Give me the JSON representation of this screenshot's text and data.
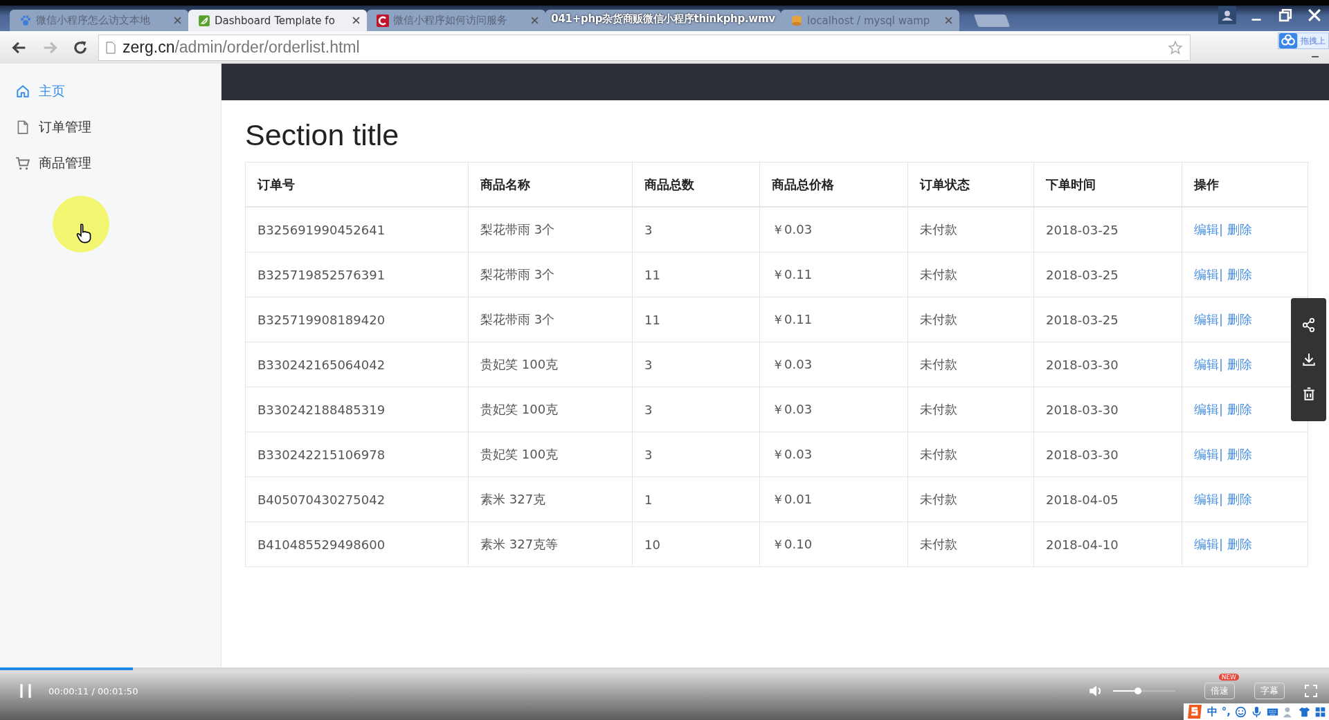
{
  "video": {
    "title": "041+php杂货商贩微信小程序thinkphp.wmv",
    "time": "00:00:11 / 00:01:50",
    "progress": {
      "level": 0.1
    },
    "volume": {
      "level": 0.4
    },
    "buttons": [
      {
        "label": "倍速",
        "badge": "NEW"
      },
      {
        "label": "字幕"
      }
    ]
  },
  "browser": {
    "tabs": [
      {
        "label": "微信小程序怎么访文本地",
        "selected": false,
        "kind": "paw"
      },
      {
        "label": "Dashboard Template fo",
        "selected": true,
        "kind": "leaf"
      },
      {
        "label": "微信小程序如何访问服务",
        "selected": false,
        "kind": "c"
      },
      {
        "label": "localhost / mysql wamp",
        "selected": false,
        "kind": "db"
      }
    ],
    "url": {
      "host": "zerg.cn",
      "path": "/admin/order/orderlist.html"
    },
    "extension_label": "拖拽上"
  },
  "sidebar": {
    "items": [
      {
        "label": "主页",
        "selected": true,
        "kind": "home"
      },
      {
        "label": "订单管理",
        "selected": false,
        "kind": "file"
      },
      {
        "label": "商品管理",
        "selected": false,
        "kind": "cart"
      }
    ]
  },
  "section_title": "Section title",
  "table": {
    "columns": [
      "订单号",
      "商品名称",
      "商品总数",
      "商品总价格",
      "订单状态",
      "下单时间",
      "操作"
    ],
    "action_separator": "|",
    "rows": [
      {
        "cells": [
          "B325691990452641",
          "梨花带雨 3个",
          "3",
          "￥0.03",
          "未付款",
          "2018-03-25"
        ],
        "actions": [
          "编辑",
          "删除"
        ]
      },
      {
        "cells": [
          "B325719852576391",
          "梨花带雨 3个",
          "11",
          "￥0.11",
          "未付款",
          "2018-03-25"
        ],
        "actions": [
          "编辑",
          "删除"
        ]
      },
      {
        "cells": [
          "B325719908189420",
          "梨花带雨 3个",
          "11",
          "￥0.11",
          "未付款",
          "2018-03-25"
        ],
        "actions": [
          "编辑",
          "删除"
        ]
      },
      {
        "cells": [
          "B330242165064042",
          "贵妃笑 100克",
          "3",
          "￥0.03",
          "未付款",
          "2018-03-30"
        ],
        "actions": [
          "编辑",
          "删除"
        ]
      },
      {
        "cells": [
          "B330242188485319",
          "贵妃笑 100克",
          "3",
          "￥0.03",
          "未付款",
          "2018-03-30"
        ],
        "actions": [
          "编辑",
          "删除"
        ]
      },
      {
        "cells": [
          "B330242215106978",
          "贵妃笑 100克",
          "3",
          "￥0.03",
          "未付款",
          "2018-03-30"
        ],
        "actions": [
          "编辑",
          "删除"
        ]
      },
      {
        "cells": [
          "B405070430275042",
          "素米 327克",
          "1",
          "￥0.01",
          "未付款",
          "2018-04-05"
        ],
        "actions": [
          "编辑",
          "删除"
        ]
      },
      {
        "cells": [
          "B410485529498600",
          "素米 327克等",
          "10",
          "￥0.10",
          "未付款",
          "2018-04-10"
        ],
        "actions": [
          "编辑",
          "删除"
        ]
      }
    ]
  },
  "ime": {
    "items": [
      "中",
      "°,"
    ]
  }
}
